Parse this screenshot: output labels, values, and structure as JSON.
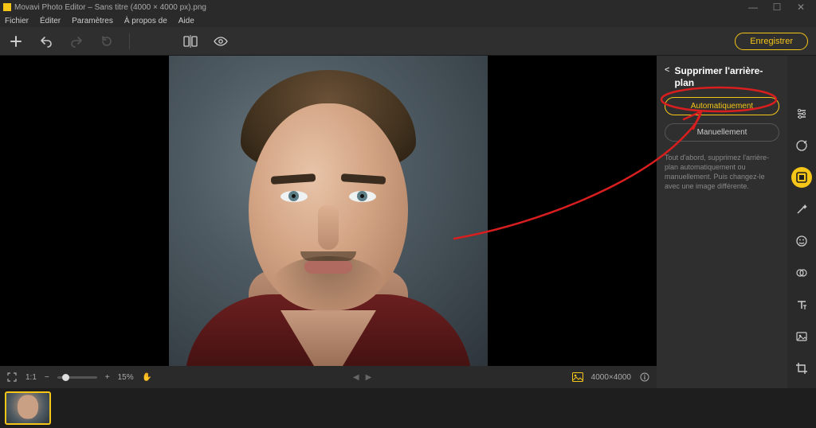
{
  "title": "Movavi Photo Editor – Sans titre (4000 × 4000 px).png",
  "menu": {
    "file": "Fichier",
    "edit": "Éditer",
    "settings": "Paramètres",
    "about": "À propos de",
    "help": "Aide"
  },
  "toolbar": {
    "save": "Enregistrer"
  },
  "canvas": {
    "zoom_ratio": "1:1",
    "zoom_pct": "15%",
    "dimensions": "4000×4000"
  },
  "panel": {
    "back": "<",
    "title": "Supprimer l'arrière-plan",
    "auto": "Automatiquement",
    "manual": "Manuellement",
    "help": "Tout d'abord, supprimez l'arrière-plan automatiquement ou manuellement. Puis changez-le avec une image différente."
  },
  "strip_tools": [
    "adjust",
    "retouch",
    "bg-remove",
    "magic",
    "emoji",
    "overlay",
    "text",
    "image",
    "crop"
  ]
}
